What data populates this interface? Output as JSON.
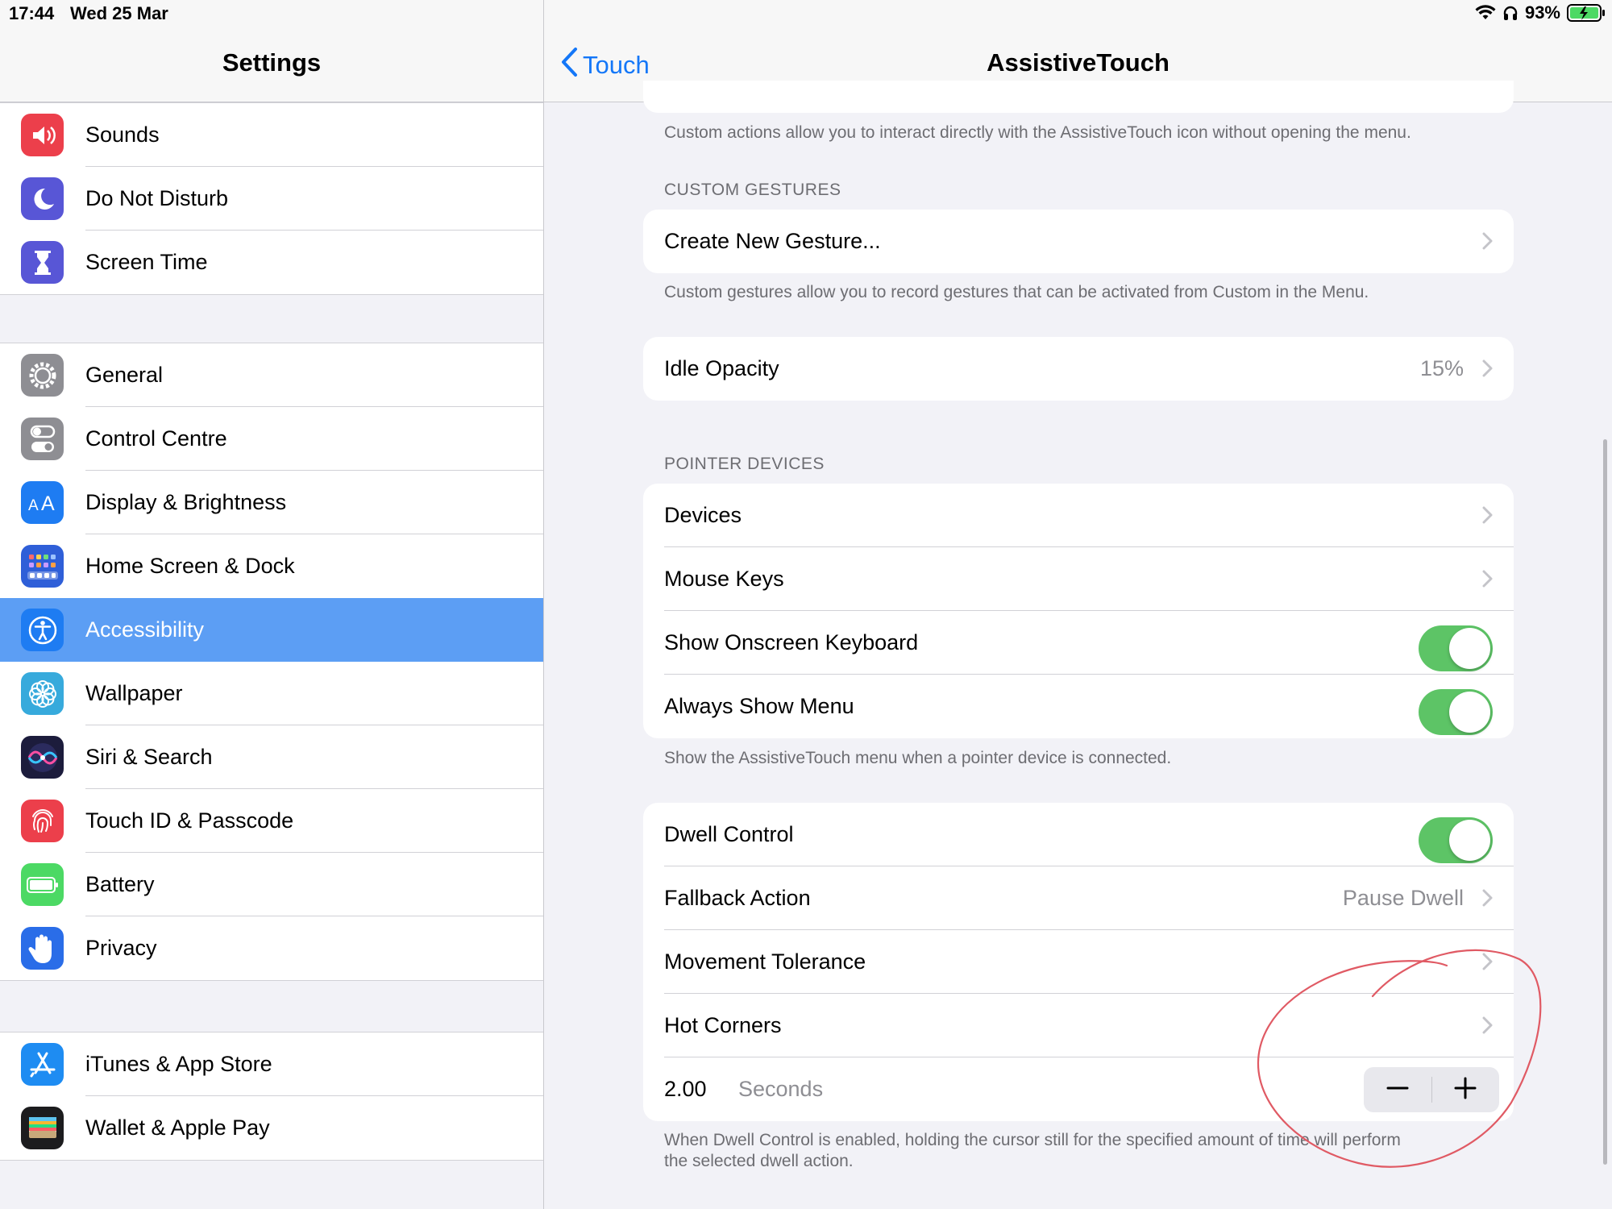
{
  "status_bar": {
    "time": "17:44",
    "date": "Wed 25 Mar",
    "battery": "93%"
  },
  "sidebar": {
    "title": "Settings",
    "groups": [
      [
        {
          "label": "Sounds",
          "icon": "speaker-icon",
          "color": "#ec3f4b"
        },
        {
          "label": "Do Not Disturb",
          "icon": "moon-icon",
          "color": "#5856d6"
        },
        {
          "label": "Screen Time",
          "icon": "hourglass-icon",
          "color": "#5856d6"
        }
      ],
      [
        {
          "label": "General",
          "icon": "gear-icon",
          "color": "#8e8e93"
        },
        {
          "label": "Control Centre",
          "icon": "switches-icon",
          "color": "#8e8e93"
        },
        {
          "label": "Display & Brightness",
          "icon": "text-size-icon",
          "color": "#1e7cf2"
        },
        {
          "label": "Home Screen & Dock",
          "icon": "app-grid-icon",
          "color": "#2f5fd8"
        },
        {
          "label": "Accessibility",
          "icon": "accessibility-icon",
          "color": "#1e7cf2",
          "selected": true
        },
        {
          "label": "Wallpaper",
          "icon": "flower-icon",
          "color": "#37aadc"
        },
        {
          "label": "Siri & Search",
          "icon": "siri-icon",
          "color": "#1c1c3c"
        },
        {
          "label": "Touch ID & Passcode",
          "icon": "fingerprint-icon",
          "color": "#ec3f4b"
        },
        {
          "label": "Battery",
          "icon": "battery-icon",
          "color": "#4cd964"
        },
        {
          "label": "Privacy",
          "icon": "hand-icon",
          "color": "#2a6de8"
        }
      ],
      [
        {
          "label": "iTunes & App Store",
          "icon": "app-store-icon",
          "color": "#1e8cf2"
        },
        {
          "label": "Wallet & Apple Pay",
          "icon": "wallet-icon",
          "color": "#1c1c1e"
        }
      ]
    ]
  },
  "detail": {
    "back_label": "Touch",
    "title": "AssistiveTouch",
    "custom_actions_note": "Custom actions allow you to interact directly with the AssistiveTouch icon without opening the menu.",
    "custom_gestures_header": "CUSTOM GESTURES",
    "create_gesture": "Create New Gesture...",
    "custom_gestures_note": "Custom gestures allow you to record gestures that can be activated from Custom in the Menu.",
    "idle_opacity": {
      "label": "Idle Opacity",
      "value": "15%"
    },
    "pointer_devices_header": "POINTER DEVICES",
    "devices": "Devices",
    "mouse_keys": "Mouse Keys",
    "show_keyboard": {
      "label": "Show Onscreen Keyboard",
      "on": true
    },
    "always_show_menu": {
      "label": "Always Show Menu",
      "on": true
    },
    "pointer_note": "Show the AssistiveTouch menu when a pointer device is connected.",
    "dwell_control": {
      "label": "Dwell Control",
      "on": true
    },
    "fallback_action": {
      "label": "Fallback Action",
      "value": "Pause Dwell"
    },
    "movement_tolerance": "Movement Tolerance",
    "hot_corners": "Hot Corners",
    "dwell_time": {
      "value": "2.00",
      "unit": "Seconds"
    },
    "dwell_note_line1": "When Dwell Control is enabled, holding the cursor still for the specified amount of time will perform",
    "dwell_note_line2": "the selected dwell action."
  },
  "colors": {
    "accent": "#1477f8",
    "toggle_on": "#5dc466",
    "selected_row": "#5c9ef4",
    "annotation": "#e05a64"
  }
}
